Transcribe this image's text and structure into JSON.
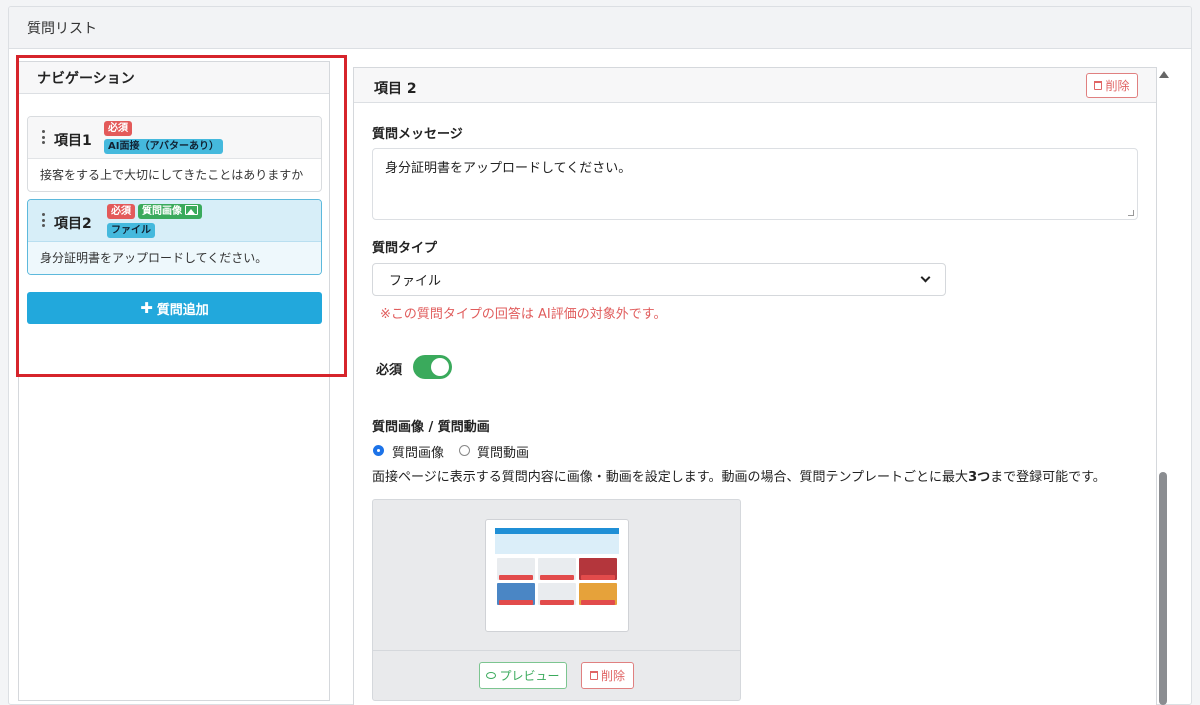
{
  "page": {
    "title": "質問リスト"
  },
  "nav": {
    "title": "ナビゲーション",
    "items": [
      {
        "title": "項目1",
        "badges": [
          "必須",
          "AI面接（アバターあり）"
        ],
        "desc": "接客をする上で大切にしてきたことはありますか"
      },
      {
        "title": "項目2",
        "badges": [
          "必須",
          "質問画像",
          "ファイル"
        ],
        "desc": "身分証明書をアップロードしてください。"
      }
    ],
    "add_label": "質問追加"
  },
  "detail": {
    "title": "項目 2",
    "delete_label": "削除",
    "message_label": "質問メッセージ",
    "message_value": "身分証明書をアップロードしてください。",
    "type_label": "質問タイプ",
    "type_value": "ファイル",
    "type_warning": "※この質問タイプの回答は AI評価の対象外です。",
    "required_label": "必須",
    "required_on": true,
    "media_label": "質問画像 / 質問動画",
    "media_options": [
      "質問画像",
      "質問動画"
    ],
    "media_selected": "質問画像",
    "help_prefix": "面接ページに表示する質問内容に画像・動画を設定します。動画の場合、質問テンプレートごとに最大",
    "help_bold": "3つ",
    "help_suffix": "まで登録可能です。",
    "preview_label": "プレビュー",
    "media_delete_label": "削除"
  },
  "colors": {
    "accent": "#22a8dc",
    "success": "#3aaa5c",
    "danger": "#e35a5a",
    "highlight_frame": "#d6242b"
  }
}
